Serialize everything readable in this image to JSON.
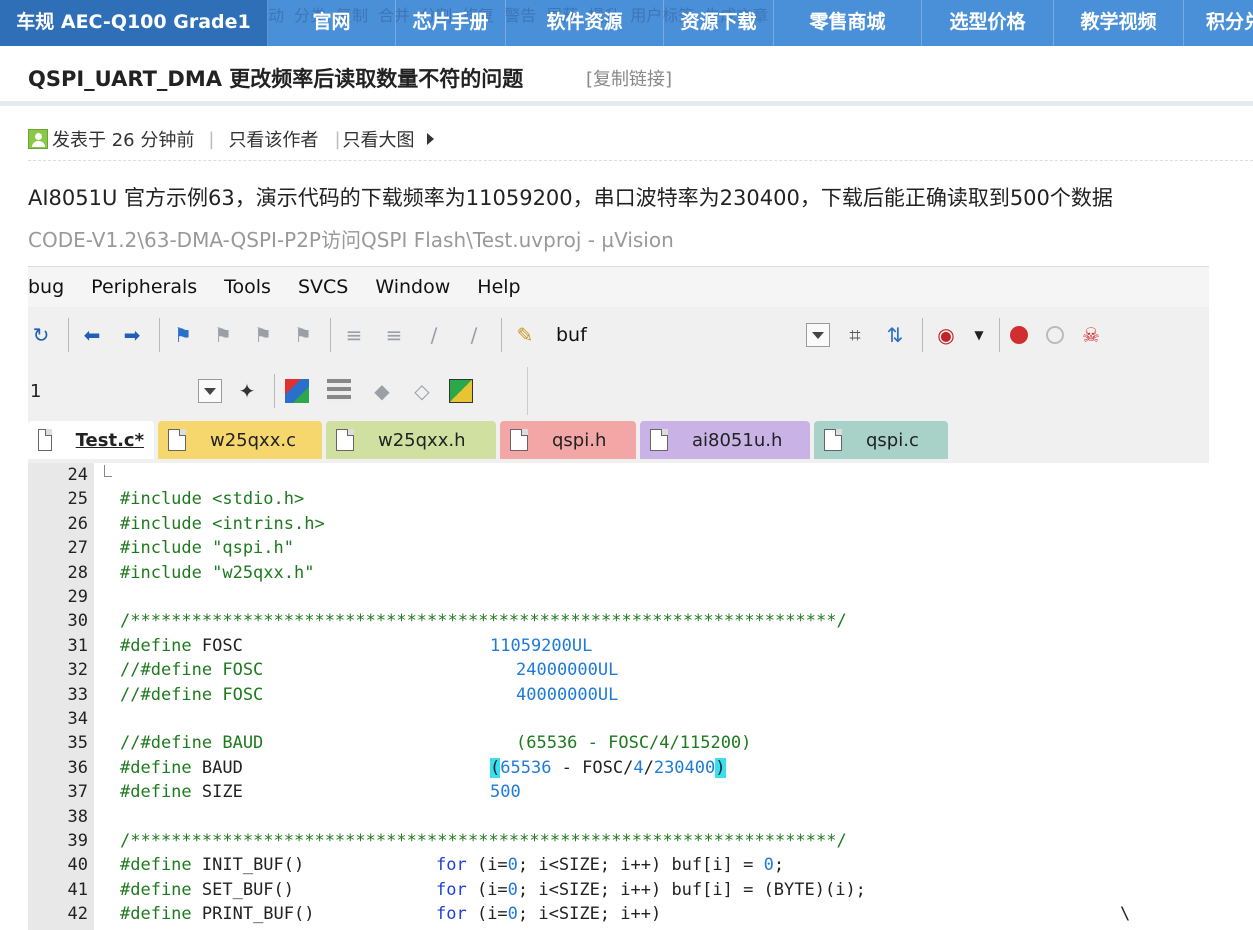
{
  "nav": {
    "ghost_items": [
      "置顶",
      "查看",
      "精华",
      "图章",
      "图标",
      "关闭",
      "移动",
      "分类",
      "复制",
      "合并",
      "分割",
      "修复",
      "警告",
      "屏蔽",
      "提升",
      "用户标签",
      "生成文章"
    ],
    "items": [
      {
        "label": "车规 AEC-Q100 Grade1",
        "active": true
      },
      {
        "label": "官网"
      },
      {
        "label": "芯片手册"
      },
      {
        "label": "软件资源"
      },
      {
        "label": "资源下载"
      },
      {
        "label": "零售商城"
      },
      {
        "label": "选型价格"
      },
      {
        "label": "教学视频"
      },
      {
        "label": "积分兑换"
      }
    ],
    "colors": {
      "bar": "#4a90d9",
      "active": "#2f6fb8"
    }
  },
  "thread": {
    "title": "QSPI_UART_DMA 更改频率后读取数量不符的问题",
    "copy_link": "[复制链接]"
  },
  "meta": {
    "posted": "发表于 26 分钟前",
    "only_author": "只看该作者",
    "big_image": "只看大图"
  },
  "post": {
    "body": "AI8051U 官方示例63，演示代码的下载频率为11059200，串口波特率为230400，下载后能正确读取到500个数据",
    "path": "CODE-V1.2\\63-DMA-QSPI-P2P访问QSPI Flash\\Test.uvproj - µVision"
  },
  "ide": {
    "menu": [
      "bug",
      "Peripherals",
      "Tools",
      "SVCS",
      "Window",
      "Help"
    ],
    "find_value": "buf",
    "combo_value": "1",
    "tabs": [
      {
        "label": "Test.c*",
        "color": "#ffffff",
        "active": true
      },
      {
        "label": "w25qxx.c",
        "color": "#f5d76e"
      },
      {
        "label": "w25qxx.h",
        "color": "#cfe0a0"
      },
      {
        "label": "qspi.h",
        "color": "#f2a6a6"
      },
      {
        "label": "ai8051u.h",
        "color": "#c9b3e6"
      },
      {
        "label": "qspi.c",
        "color": "#a8d2c8"
      }
    ],
    "code": {
      "line_numbers": [
        "24",
        "25",
        "26",
        "27",
        "28",
        "29",
        "30",
        "31",
        "32",
        "33",
        "34",
        "35",
        "36",
        "37",
        "38",
        "39",
        "40",
        "41",
        "42"
      ],
      "l25": "#include <stdio.h>",
      "l26": "#include <intrins.h>",
      "l27": "#include \"qspi.h\"",
      "l28": "#include \"w25qxx.h\"",
      "l30": "/*********************************************************************/",
      "l31_a": "#define ",
      "l31_b": "FOSC",
      "l31_c": "11059200UL",
      "l32_a": "//#define FOSC",
      "l32_c": "24000000UL",
      "l33_a": "//#define FOSC",
      "l33_c": "40000000UL",
      "l35_a": "//#define BAUD",
      "l35_c": "(65536 - FOSC/4/115200)",
      "l36_a": "#define ",
      "l36_b": "BAUD",
      "l36_c1": "(",
      "l36_c2": "65536",
      "l36_c3": " - FOSC/",
      "l36_c4": "4",
      "l36_c5": "/",
      "l36_c6": "230400",
      "l36_c7": ")",
      "l37_a": "#define ",
      "l37_b": "SIZE",
      "l37_c": "500",
      "l39": "/*********************************************************************/",
      "l40_a": "#define ",
      "l40_b": "INIT_BUF()",
      "l40_kw": "for",
      "l40_c1": " (i=",
      "l40_n1": "0",
      "l40_c2": "; i<SIZE; i++) buf[i] = ",
      "l40_n2": "0",
      "l40_c3": ";",
      "l41_a": "#define ",
      "l41_b": "SET_BUF()",
      "l41_kw": "for",
      "l41_c1": " (i=",
      "l41_n1": "0",
      "l41_c2": "; i<SIZE; i++) buf[i] = (BYTE)(i);",
      "l42_a": "#define ",
      "l42_b": "PRINT_BUF()",
      "l42_kw": "for",
      "l42_c1": " (i=",
      "l42_n1": "0",
      "l42_c2": "; i<SIZE; i++)",
      "l42_bs": "\\"
    }
  }
}
